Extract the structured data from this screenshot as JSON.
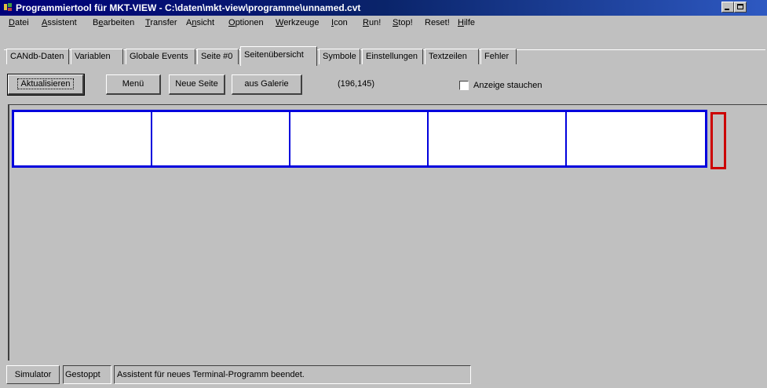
{
  "window": {
    "title": "Programmiertool für MKT-VIEW - C:\\daten\\mkt-view\\programme\\unnamed.cvt",
    "title_bar_color": "#0a246a"
  },
  "menu": [
    {
      "label": "Datei",
      "hotkey": "D",
      "rest": "atei"
    },
    {
      "label": "Assistent",
      "hotkey": "A",
      "rest": "ssistent"
    },
    {
      "label": "Bearbeiten",
      "pre": "B",
      "hotkey": "e",
      "rest": "arbeiten"
    },
    {
      "label": "Transfer",
      "hotkey": "T",
      "rest": "ransfer"
    },
    {
      "label": "Ansicht",
      "pre": "A",
      "hotkey": "n",
      "rest": "sicht"
    },
    {
      "label": "Optionen",
      "hotkey": "O",
      "rest": "ptionen"
    },
    {
      "label": "Werkzeuge",
      "hotkey": "W",
      "rest": "erkzeuge"
    },
    {
      "label": "Icon",
      "hotkey": "I",
      "rest": "con"
    },
    {
      "label": "Run!",
      "hotkey": "R",
      "rest": "un!"
    },
    {
      "label": "Stop!",
      "hotkey": "S",
      "rest": "top!"
    },
    {
      "label": "Reset!",
      "pre": "Reset!",
      "hotkey": "",
      "rest": ""
    },
    {
      "label": "Hilfe",
      "hotkey": "H",
      "rest": "ilfe"
    }
  ],
  "tabs": [
    {
      "label": "CANdb-Daten"
    },
    {
      "label": "Variablen"
    },
    {
      "label": "Globale Events"
    },
    {
      "label": "Seite #0"
    },
    {
      "label": "Seitenübersicht",
      "active": true
    },
    {
      "label": "Symbole"
    },
    {
      "label": "Einstellungen"
    },
    {
      "label": "Textzeilen"
    },
    {
      "label": "Fehler"
    }
  ],
  "toolbar": {
    "refresh_label": "Aktualisieren",
    "menu_label": "Menü",
    "new_page_label": "Neue Seite",
    "from_gallery_label": "aus Galerie",
    "coords": "(196,145)",
    "compress_label": "Anzeige stauchen",
    "compress_checked": false
  },
  "canvas": {
    "page_count": 5,
    "strip_border_color": "#0000dd",
    "marker_color": "#cc0000"
  },
  "status": {
    "simulator_label": "Simulator",
    "state_label": "Gestoppt",
    "message": "Assistent für neues Terminal-Programm beendet."
  }
}
